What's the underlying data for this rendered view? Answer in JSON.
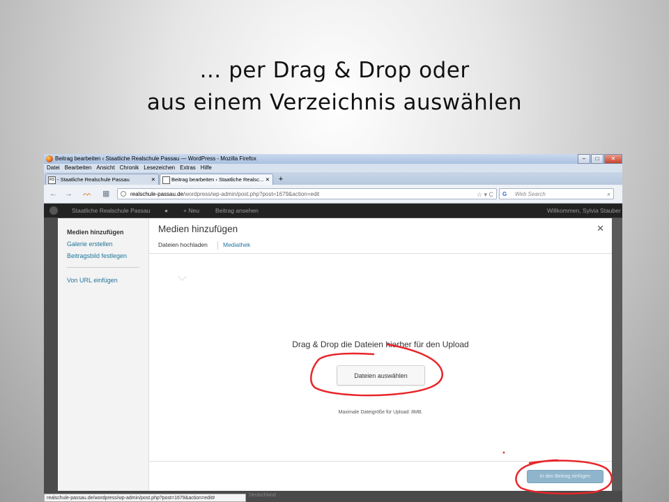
{
  "slide": {
    "title_line1": "… per Drag & Drop oder",
    "title_line2": "aus einem Verzeichnis auswählen"
  },
  "browser": {
    "window_title": "Beitrag bearbeiten ‹ Staatliche Realschule Passau — WordPress - Mozilla Firefox",
    "window_buttons": {
      "minimize": "–",
      "maximize": "□",
      "close": "✕"
    },
    "menu": [
      "Datei",
      "Bearbeiten",
      "Ansicht",
      "Chronik",
      "Lesezeichen",
      "Extras",
      "Hilfe"
    ],
    "tabs": [
      {
        "favicon": "RS",
        "label": "- Staatliche Realschule Passau",
        "close": "✕"
      },
      {
        "favicon": "",
        "label": "Beitrag bearbeiten ‹ Staatliche Realsc...",
        "close": "✕"
      }
    ],
    "new_tab": "+",
    "nav": {
      "back": "←",
      "forward": "→",
      "bookmarks": "▦",
      "home": "⌂"
    },
    "url_host": "realschule-passau.de",
    "url_path": "/wordpress/wp-admin/post.php?post=1679&action=edit",
    "url_right_icons": "☆ ▾ C",
    "search_engine": "G",
    "search_placeholder": "Web Search",
    "search_icon": "⌕",
    "status_url": "realschule-passau.de/wordpress/wp-admin/post.php?post=1679&action=edit#",
    "page_peek_text": "Deutschland"
  },
  "wp_adminbar": {
    "site_name": "Staatliche Realschule Passau",
    "comments_icon": "●",
    "new_label": "+ Neu",
    "view_post": "Beitrag ansehen",
    "greeting": "Willkommen, Sylvia Stauber"
  },
  "media_modal": {
    "sidebar": [
      {
        "label": "Medien hinzufügen",
        "active": true
      },
      {
        "label": "Galerie erstellen",
        "active": false
      },
      {
        "label": "Beitragsbild festlegen",
        "active": false
      },
      {
        "label": "Von URL einfügen",
        "active": false
      }
    ],
    "title": "Medien hinzufügen",
    "close_icon": "✕",
    "tabs": [
      "Dateien hochladen",
      "Mediathek"
    ],
    "drop_instructions": "Drag & Drop die Dateien hierher für den Upload",
    "select_button": "Dateien auswählen",
    "max_upload": "Maximale Dateigröße für Upload: 8MB.",
    "insert_button": "In den Beitrag einfügen"
  },
  "colors": {
    "wp_link": "#21759b",
    "admin_bar": "#222222",
    "annotation_red": "#e8262b"
  }
}
